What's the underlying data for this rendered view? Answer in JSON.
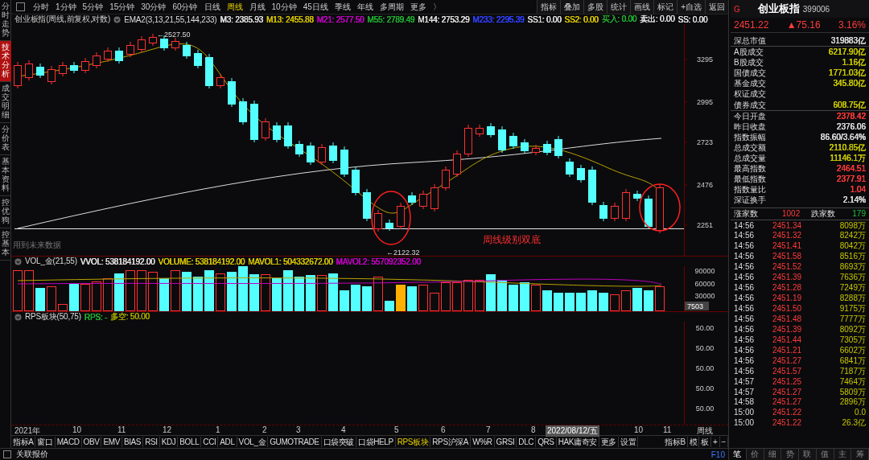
{
  "side_tabs": [
    {
      "label": "分时走势",
      "selected": false
    },
    {
      "label": "技术分析",
      "selected": true
    },
    {
      "label": "成交明细",
      "selected": false
    },
    {
      "label": "分价表",
      "selected": false
    },
    {
      "label": "基本资料",
      "selected": false
    },
    {
      "label": "控优狗",
      "selected": false
    },
    {
      "label": "控基本",
      "selected": false
    }
  ],
  "toolbar": {
    "periods": [
      {
        "label": "分时",
        "selected": false
      },
      {
        "label": "1分钟",
        "selected": false
      },
      {
        "label": "5分钟",
        "selected": false
      },
      {
        "label": "15分钟",
        "selected": false
      },
      {
        "label": "30分钟",
        "selected": false
      },
      {
        "label": "60分钟",
        "selected": false
      },
      {
        "label": "日线",
        "selected": false
      },
      {
        "label": "周线",
        "selected": true
      },
      {
        "label": "月线",
        "selected": false
      },
      {
        "label": "10分钟",
        "selected": false
      },
      {
        "label": "45日线",
        "selected": false
      },
      {
        "label": "季线",
        "selected": false
      },
      {
        "label": "年线",
        "selected": false
      },
      {
        "label": "多周期",
        "selected": false
      },
      {
        "label": "更多",
        "selected": false
      }
    ],
    "more_arrow": "〉",
    "actions": [
      "指标",
      "叠加",
      "多股",
      "统计",
      "画线",
      "标记",
      "+自选",
      "返回"
    ]
  },
  "main_chart": {
    "title": "创业板指(周线,前复权,对数)",
    "indicator": "EMA2(3,13,21,55,144,233)",
    "legend": [
      {
        "text": "M3: 2385.93",
        "color": "#dddddd"
      },
      {
        "text": "M13: 2455.88",
        "color": "#d4c200"
      },
      {
        "text": "M21: 2577.50",
        "color": "#c000c0"
      },
      {
        "text": "M55: 2789.49",
        "color": "#20b030"
      },
      {
        "text": "M144: 2753.29",
        "color": "#dddddd"
      },
      {
        "text": "M233: 2295.39",
        "color": "#3040ff"
      },
      {
        "text": "SS1: 0.00",
        "color": "#dddddd"
      },
      {
        "text": "SS2: 0.00",
        "color": "#d4c200"
      },
      {
        "text": "买入: 0.00",
        "color": "#20b030"
      },
      {
        "text": "卖出: 0.00",
        "color": "#dddddd"
      },
      {
        "text": "SS: 0.00",
        "color": "#dddddd"
      }
    ],
    "y_axis": [
      "3295",
      "2995",
      "2723",
      "2476",
      "2251"
    ],
    "high_label": "←2527.50",
    "low_label": "←2122.32",
    "note": "周线级别双底",
    "warning": "用到未来数据"
  },
  "volume": {
    "title": "VOL_金(21,55)",
    "legend": [
      {
        "text": "VVOL: 538184192.00",
        "color": "#dddddd"
      },
      {
        "text": "VOLUME: 538184192.00",
        "color": "#d4c200"
      },
      {
        "text": "MAVOL1: 504332672.00",
        "color": "#d4c200"
      },
      {
        "text": "MAVOL2: 557092352.00",
        "color": "#c000c0"
      }
    ],
    "y_axis": [
      "90000",
      "60000",
      "30000"
    ],
    "current": "7503"
  },
  "rps": {
    "title": "RPS板块(50,75)",
    "legend": [
      {
        "text": "RPS: -",
        "color": "#20b030"
      },
      {
        "text": "多空: 50.00",
        "color": "#a0a000"
      }
    ],
    "y_axis": [
      "50.00",
      "50.00",
      "50.00",
      "50.00",
      "50.00"
    ]
  },
  "x_axis": [
    {
      "label": "2021年",
      "selected": false
    },
    {
      "label": "10",
      "selected": false
    },
    {
      "label": "11",
      "selected": false
    },
    {
      "label": "12",
      "selected": false
    },
    {
      "label": "1",
      "selected": false
    },
    {
      "label": "2",
      "selected": false
    },
    {
      "label": "3",
      "selected": false
    },
    {
      "label": "4",
      "selected": false
    },
    {
      "label": "5",
      "selected": false
    },
    {
      "label": "6",
      "selected": false
    },
    {
      "label": "7",
      "selected": false
    },
    {
      "label": "8",
      "selected": false
    },
    {
      "label": "2022/08/12/五",
      "selected": true
    },
    {
      "label": "10",
      "selected": false
    },
    {
      "label": "11",
      "selected": false
    },
    {
      "label": "周线",
      "selected": false
    }
  ],
  "indicator_tabs": [
    {
      "label": "指标A",
      "selected": false
    },
    {
      "label": "窗口",
      "selected": false
    },
    {
      "label": "MACD",
      "selected": false
    },
    {
      "label": "OBV",
      "selected": false
    },
    {
      "label": "EMV",
      "selected": false
    },
    {
      "label": "BIAS",
      "selected": false
    },
    {
      "label": "RSI",
      "selected": false
    },
    {
      "label": "KDJ",
      "selected": false
    },
    {
      "label": "BOLL",
      "selected": false
    },
    {
      "label": "CCI",
      "selected": false
    },
    {
      "label": "ADL",
      "selected": false
    },
    {
      "label": "VOL_金",
      "selected": false
    },
    {
      "label": "GUMOTRADE",
      "selected": false
    },
    {
      "label": "口袋突破",
      "selected": false
    },
    {
      "label": "口袋HELP",
      "selected": false
    },
    {
      "label": "RPS板块",
      "selected": true
    },
    {
      "label": "RPS沪深A",
      "selected": false
    },
    {
      "label": "W%R",
      "selected": false
    },
    {
      "label": "GRSI",
      "selected": false
    },
    {
      "label": "DLC",
      "selected": false
    },
    {
      "label": "QRS",
      "selected": false
    },
    {
      "label": "HAK庸奇安",
      "selected": false
    },
    {
      "label": "更多",
      "selected": false
    },
    {
      "label": "设置",
      "selected": false
    }
  ],
  "indicator_tabs_right": [
    "指标B",
    "模",
    "板",
    "+",
    "−"
  ],
  "status_bar": {
    "label": "关联报价",
    "key": "F10"
  },
  "quote": {
    "mark": "G",
    "name": "创业板指",
    "code": "399006",
    "price": "2451.22",
    "change": "▲75.16",
    "percent": "3.16%"
  },
  "stats": [
    {
      "label": "深总市值",
      "value": "319883亿",
      "color": "#dddddd"
    },
    {
      "label": "A股成交",
      "value": "6217.90亿",
      "color": "#c8c800"
    },
    {
      "label": "B股成交",
      "value": "1.16亿",
      "color": "#c8c800"
    },
    {
      "label": "国债成交",
      "value": "1771.03亿",
      "color": "#c8c800"
    },
    {
      "label": "基金成交",
      "value": "345.80亿",
      "color": "#c8c800"
    },
    {
      "label": "权证成交"
    },
    {
      "label": "债券成交",
      "value": "608.75亿",
      "color": "#c8c800"
    },
    {
      "label": "今日开盘",
      "value": "2378.42",
      "color": "#ff3b3b"
    },
    {
      "label": "昨日收盘",
      "value": "2376.06",
      "color": "#dddddd"
    },
    {
      "label": "指数振幅",
      "value": "86.60/3.64%",
      "color": "#dddddd"
    },
    {
      "label": "总成交额",
      "value": "2110.85亿",
      "color": "#c8c800"
    },
    {
      "label": "总成交量",
      "value": "11146.1万",
      "color": "#c8c800"
    },
    {
      "label": "最高指数",
      "value": "2464.51",
      "color": "#ff3b3b"
    },
    {
      "label": "最低指数",
      "value": "2377.91",
      "color": "#ff3b3b"
    },
    {
      "label": "指数量比",
      "value": "1.04",
      "color": "#ff3b3b"
    },
    {
      "label": "深证换手",
      "value": "2.14%",
      "color": "#dddddd"
    }
  ],
  "breadth": {
    "up_label": "涨家数",
    "up": "1002",
    "down_label": "跌家数",
    "down": "179"
  },
  "ticks": [
    {
      "time": "14:56",
      "price": "2451.34",
      "volume": "8098万"
    },
    {
      "time": "14:56",
      "price": "2451.32",
      "volume": "8242万"
    },
    {
      "time": "14:56",
      "price": "2451.41",
      "volume": "8042万"
    },
    {
      "time": "14:56",
      "price": "2451.58",
      "volume": "8516万"
    },
    {
      "time": "14:56",
      "price": "2451.52",
      "volume": "8693万"
    },
    {
      "time": "14:56",
      "price": "2451.39",
      "volume": "7636万"
    },
    {
      "time": "14:56",
      "price": "2451.28",
      "volume": "7249万"
    },
    {
      "time": "14:56",
      "price": "2451.19",
      "volume": "8288万"
    },
    {
      "time": "14:56",
      "price": "2451.50",
      "volume": "9175万"
    },
    {
      "time": "14:56",
      "price": "2451.48",
      "volume": "7777万"
    },
    {
      "time": "14:56",
      "price": "2451.39",
      "volume": "8092万"
    },
    {
      "time": "14:56",
      "price": "2451.44",
      "volume": "7305万"
    },
    {
      "time": "14:56",
      "price": "2451.21",
      "volume": "6602万"
    },
    {
      "time": "14:56",
      "price": "2451.27",
      "volume": "6841万"
    },
    {
      "time": "14:56",
      "price": "2451.57",
      "volume": "7187万"
    },
    {
      "time": "14:57",
      "price": "2451.25",
      "volume": "7464万"
    },
    {
      "time": "14:57",
      "price": "2451.27",
      "volume": "5809万"
    },
    {
      "time": "14:58",
      "price": "2451.27",
      "volume": "2896万"
    },
    {
      "time": "15:00",
      "price": "2451.22",
      "volume": "0.0"
    },
    {
      "time": "15:00",
      "price": "2451.22",
      "volume": "26.3亿"
    }
  ],
  "bottom_tabs": [
    {
      "label": "笔",
      "selected": true
    },
    {
      "label": "价",
      "selected": false
    },
    {
      "label": "细",
      "selected": false
    },
    {
      "label": "势",
      "selected": false
    },
    {
      "label": "联",
      "selected": false
    },
    {
      "label": "值",
      "selected": false
    },
    {
      "label": "主",
      "selected": false
    },
    {
      "label": "筹",
      "selected": false
    }
  ]
}
